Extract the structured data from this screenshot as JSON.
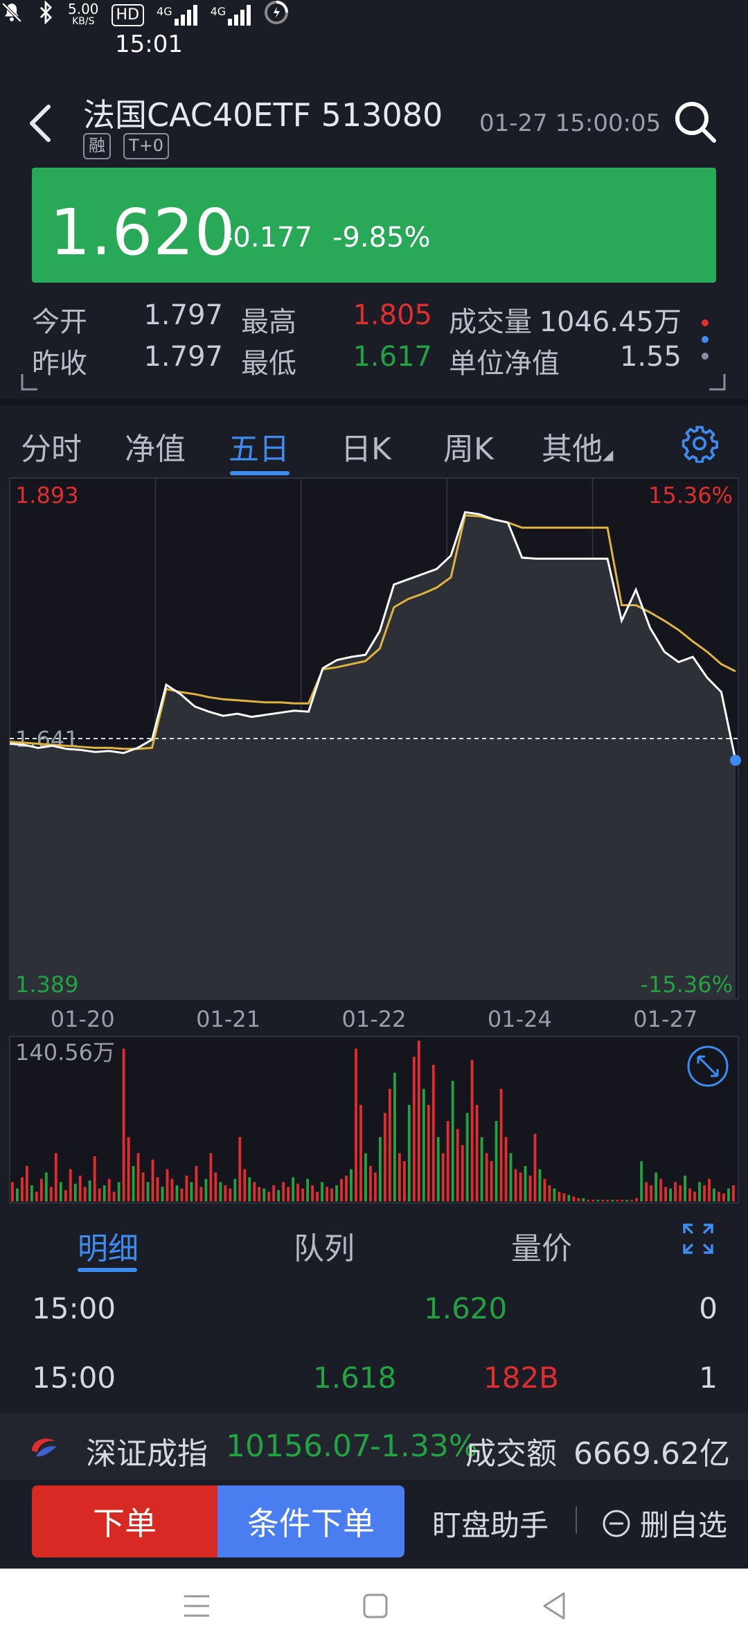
{
  "status_bar": {
    "time": "15:01",
    "speed_top": "5.00",
    "speed_unit": "KB/S",
    "hd_label": "HD",
    "net1": "4G",
    "net2": "4G"
  },
  "header": {
    "title": "法国CAC40ETF 513080",
    "tag_margin": "融",
    "tag_t0": "T+0",
    "datetime": "01-27 15:00:05"
  },
  "quote": {
    "price": "1.620",
    "change": "-0.177",
    "change_pct": "-9.85%"
  },
  "stats": {
    "open_label": "今开",
    "open": "1.797",
    "high_label": "最高",
    "high": "1.805",
    "volume_label": "成交量",
    "volume": "1046.45万",
    "prev_label": "昨收",
    "prev": "1.797",
    "low_label": "最低",
    "low": "1.617",
    "nav_label": "单位净值",
    "nav": "1.55"
  },
  "tabs": {
    "t1": "分时",
    "t2": "净值",
    "t3": "五日",
    "t4": "日K",
    "t5": "周K",
    "t6": "其他"
  },
  "chart_data": {
    "type": "line",
    "title": "",
    "x_dates": [
      "01-20",
      "01-21",
      "01-22",
      "01-24",
      "01-27"
    ],
    "y_top_label": "1.893",
    "y_bottom_label": "1.389",
    "pct_top_label": "15.36%",
    "pct_bottom_label": "-15.36%",
    "ylim": [
      1.389,
      1.893
    ],
    "baseline_label": "1.641",
    "baseline": 1.641,
    "series": [
      {
        "values": [
          1.636,
          1.635,
          1.632,
          1.634,
          1.631,
          1.63,
          1.628,
          1.629,
          1.627,
          1.632,
          1.64,
          1.693,
          1.684,
          1.672,
          1.667,
          1.663,
          1.665,
          1.662,
          1.664,
          1.666,
          1.668,
          1.667,
          1.709,
          1.717,
          1.72,
          1.722,
          1.745,
          1.79,
          1.795,
          1.8,
          1.805,
          1.818,
          1.86,
          1.858,
          1.853,
          1.85,
          1.816,
          1.815,
          1.815,
          1.815,
          1.815,
          1.815,
          1.815,
          1.755,
          1.785,
          1.748,
          1.725,
          1.715,
          1.72,
          1.7,
          1.686,
          1.62
        ]
      },
      {
        "values": [
          1.638,
          1.637,
          1.636,
          1.635,
          1.634,
          1.633,
          1.632,
          1.632,
          1.631,
          1.631,
          1.632,
          1.689,
          1.686,
          1.684,
          1.681,
          1.679,
          1.678,
          1.677,
          1.676,
          1.676,
          1.675,
          1.675,
          1.708,
          1.71,
          1.713,
          1.716,
          1.728,
          1.768,
          1.776,
          1.781,
          1.787,
          1.797,
          1.857,
          1.856,
          1.853,
          1.85,
          1.845,
          1.845,
          1.845,
          1.845,
          1.845,
          1.845,
          1.845,
          1.77,
          1.77,
          1.763,
          1.755,
          1.746,
          1.735,
          1.725,
          1.713,
          1.706
        ]
      }
    ]
  },
  "volume": {
    "max_label": "140.56万",
    "bars": [
      12,
      8,
      15,
      22,
      10,
      6,
      14,
      18,
      9,
      30,
      12,
      7,
      20,
      11,
      16,
      9,
      13,
      28,
      8,
      10,
      14,
      6,
      12,
      95,
      40,
      22,
      30,
      18,
      12,
      26,
      15,
      9,
      20,
      14,
      10,
      8,
      16,
      12,
      22,
      9,
      14,
      30,
      18,
      12,
      10,
      8,
      14,
      40,
      20,
      15,
      12,
      9,
      8,
      6,
      10,
      7,
      12,
      9,
      15,
      11,
      8,
      14,
      10,
      6,
      12,
      9,
      8,
      10,
      14,
      16,
      20,
      95,
      60,
      30,
      22,
      18,
      40,
      55,
      70,
      80,
      30,
      25,
      60,
      90,
      100,
      70,
      60,
      85,
      40,
      30,
      50,
      75,
      45,
      35,
      55,
      88,
      60,
      40,
      30,
      25,
      50,
      70,
      40,
      30,
      20,
      18,
      22,
      16,
      42,
      20,
      14,
      10,
      8,
      6,
      5,
      4,
      3,
      2,
      2,
      1,
      1,
      1,
      1,
      1,
      1,
      1,
      1,
      1,
      1,
      2,
      25,
      12,
      10,
      18,
      14,
      9,
      8,
      12,
      10,
      16,
      8,
      6,
      12,
      10,
      14,
      8,
      6,
      5,
      8,
      10
    ],
    "up_color": "#e02d2d",
    "down_color": "#21a341"
  },
  "detail_tabs": {
    "t1": "明细",
    "t2": "队列",
    "t3": "量价"
  },
  "trades": [
    {
      "time": "15:00",
      "buy": "",
      "price": "1.620",
      "vol": "",
      "count": "0"
    },
    {
      "time": "15:00",
      "buy": "1.618",
      "price": "",
      "vol": "182B",
      "count": "1"
    }
  ],
  "index_bar": {
    "name": "深证成指",
    "value": "10156.07",
    "change_pct": "-1.33%",
    "turnover_label": "成交额",
    "turnover": "6669.62亿"
  },
  "actions": {
    "order": "下单",
    "conditional": "条件下单",
    "assistant": "盯盘助手",
    "remove_watch": "删自选"
  },
  "colors": {
    "background": "#1b1d26",
    "accent": "#3f8cf0",
    "price_box": "#27a957",
    "up": "#e02d2d",
    "down": "#21a341",
    "avg_line": "#e0b43c"
  }
}
